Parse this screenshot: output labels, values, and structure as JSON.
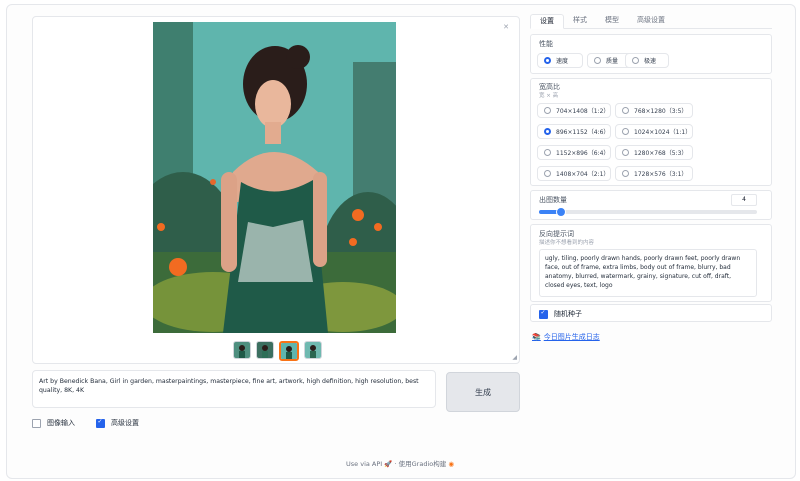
{
  "gallery": {
    "image_alt": "Painting of a girl in a green dress in a garden",
    "thumbnails": [
      {
        "name": "thumbnail-1",
        "active": false
      },
      {
        "name": "thumbnail-2",
        "active": false
      },
      {
        "name": "thumbnail-3",
        "active": true
      },
      {
        "name": "thumbnail-4",
        "active": false
      }
    ]
  },
  "prompt": {
    "value": "Art by Benedick Bana, Girl in garden, masterpaintings, masterpiece, fine art, artwork, high definition, high resolution, best quality, 8K, 4K"
  },
  "generate_label": "生成",
  "options": {
    "image_input": {
      "label": "图像输入",
      "checked": false
    },
    "advanced": {
      "label": "高级设置",
      "checked": true
    }
  },
  "footer": {
    "api_text": "Use via API",
    "separator": "·",
    "built_text": "使用Gradio构建"
  },
  "tabs": [
    "设置",
    "样式",
    "模型",
    "高级设置"
  ],
  "performance": {
    "label": "性能",
    "options": [
      "速度",
      "质量",
      "极速"
    ],
    "selected": "速度"
  },
  "aspect": {
    "label": "宽高比",
    "sublabel": "宽 × 高",
    "options": [
      "704×1408（1:2）",
      "768×1280（3:5）",
      "896×1152（4:6）",
      "1024×1024（1:1）",
      "1152×896（6:4）",
      "1280×768（5:3）",
      "1408×704（2:1）",
      "1728×576（3:1）"
    ],
    "selected": "896×1152（4:6）"
  },
  "image_count": {
    "label": "出图数量",
    "value": 4,
    "min": 1,
    "max": 32
  },
  "negative": {
    "label": "反向提示词",
    "sublabel": "描述你不想看到的内容",
    "value": "ugly, tiling, poorly drawn hands, poorly drawn feet, poorly drawn face, out of frame, extra limbs, body out of frame, blurry, bad anatomy, blurred, watermark, grainy, signature, cut off, draft, closed eyes, text, logo"
  },
  "random_seed": {
    "label": "随机种子",
    "checked": true
  },
  "log_link": "今日图片生成日志",
  "colors": {
    "accent": "#2563eb",
    "thumb_active": "#f97316",
    "image_bg": "#5fb5ad"
  }
}
